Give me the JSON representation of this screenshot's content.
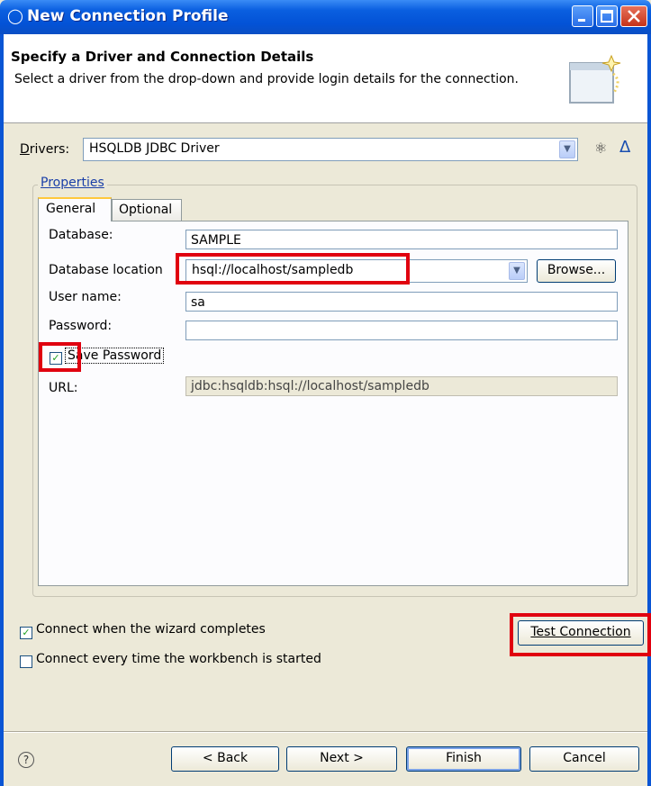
{
  "window": {
    "title": "New Connection Profile"
  },
  "banner": {
    "title": "Specify a Driver and Connection Details",
    "description": "Select a driver from the drop-down and provide login details for the connection."
  },
  "drivers": {
    "label": "Drivers:",
    "selected": "HSQLDB JDBC Driver"
  },
  "properties": {
    "group_label": "Properties",
    "tabs": [
      {
        "label": "General",
        "active": true
      },
      {
        "label": "Optional",
        "active": false
      }
    ],
    "fields": {
      "database_label": "Database:",
      "database_value": "SAMPLE",
      "location_label": "Database location",
      "location_value": "hsql://localhost/sampledb",
      "browse_label": "Browse...",
      "username_label": "User name:",
      "username_value": "sa",
      "password_label": "Password:",
      "password_value": "",
      "save_password_label": "Save Password",
      "save_password_checked": true,
      "url_label": "URL:",
      "url_value": "jdbc:hsqldb:hsql://localhost/sampledb"
    }
  },
  "options": {
    "connect_on_complete_label": "Connect when the wizard completes",
    "connect_on_complete_checked": true,
    "connect_every_time_label": "Connect every time the workbench is started",
    "connect_every_time_checked": false,
    "test_connection_label": "Test Connection"
  },
  "footer": {
    "back_label": "< Back",
    "next_label": "Next >",
    "finish_label": "Finish",
    "cancel_label": "Cancel"
  },
  "colors": {
    "titlebar": "#0a5fe0",
    "highlight": "#e0000f",
    "dialog_bg": "#ece9d8"
  }
}
